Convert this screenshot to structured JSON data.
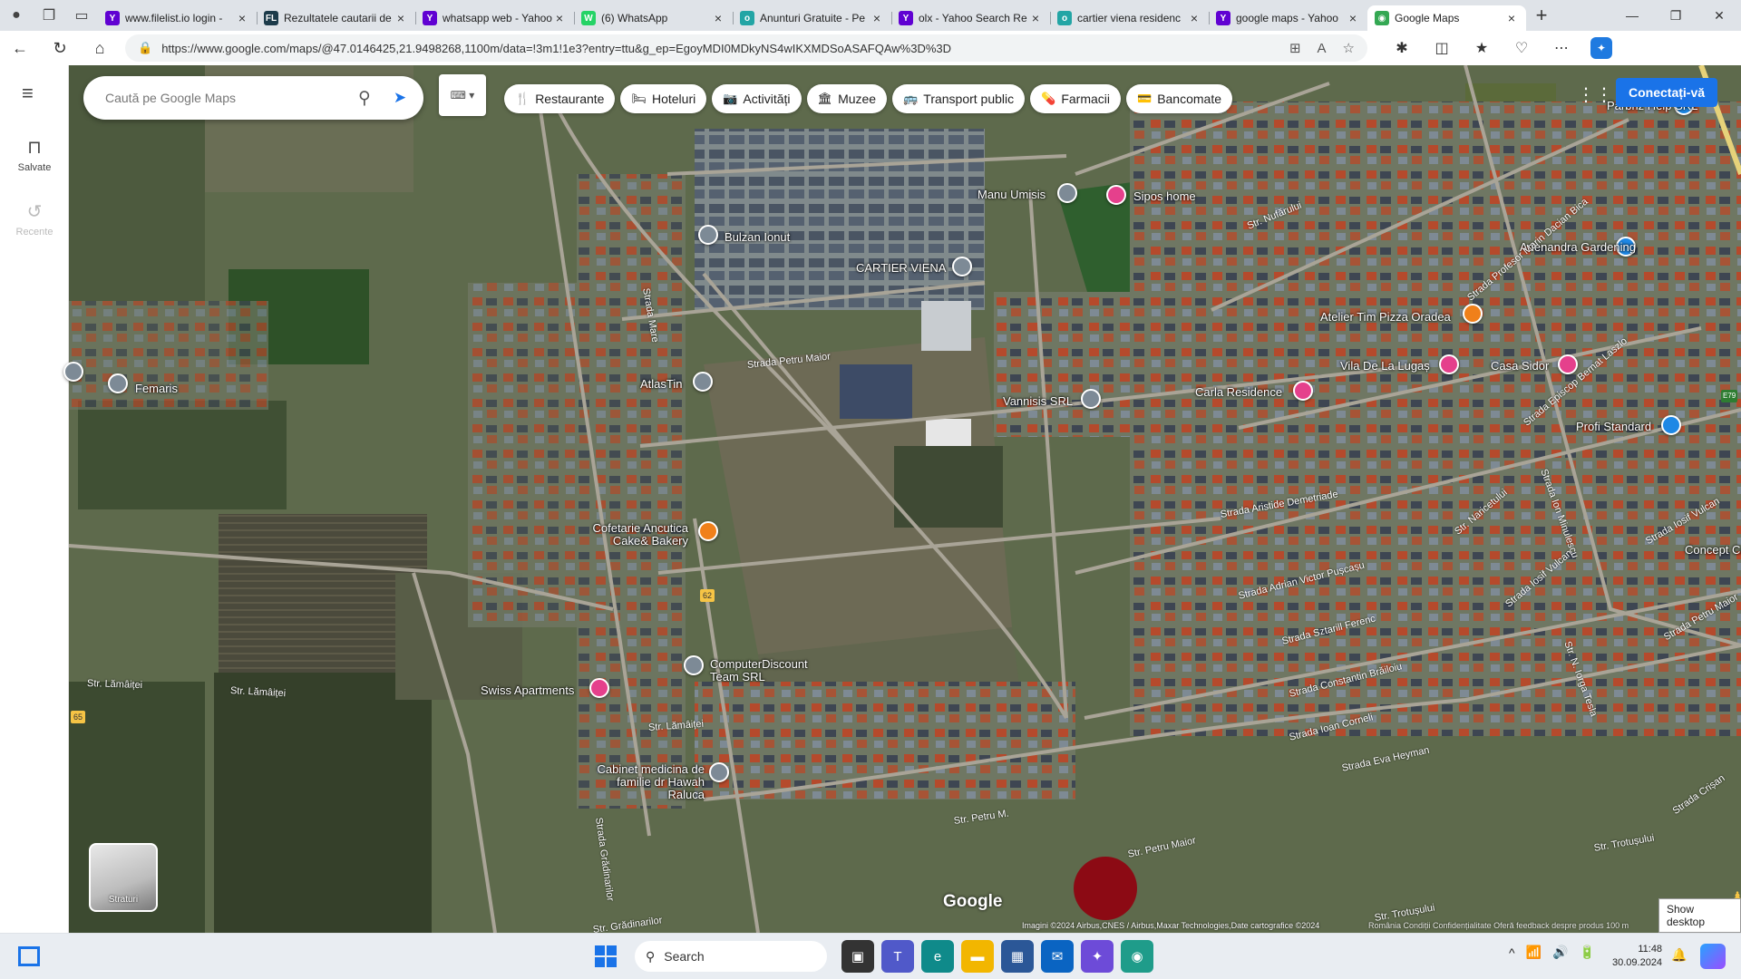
{
  "browser": {
    "tabs": [
      {
        "title": "www.filelist.io login -",
        "fav": "Y",
        "favColor": "#6001d2"
      },
      {
        "title": "Rezultatele cautarii de",
        "fav": "FL",
        "favColor": "#1c3b4a"
      },
      {
        "title": "whatsapp web - Yahoo",
        "fav": "Y",
        "favColor": "#6001d2"
      },
      {
        "title": "(6) WhatsApp",
        "fav": "W",
        "favColor": "#25d366"
      },
      {
        "title": "Anunturi Gratuite - Pe",
        "fav": "o",
        "favColor": "#23a5a5"
      },
      {
        "title": "olx - Yahoo Search Re",
        "fav": "Y",
        "favColor": "#6001d2"
      },
      {
        "title": "cartier viena residenc",
        "fav": "o",
        "favColor": "#23a5a5"
      },
      {
        "title": "google maps - Yahoo",
        "fav": "Y",
        "favColor": "#6001d2"
      },
      {
        "title": "Google Maps",
        "fav": "◉",
        "favColor": "#34a853",
        "active": true
      }
    ],
    "url": "https://www.google.com/maps/@47.0146425,21.9498268,1100m/data=!3m1!1e3?entry=ttu&g_ep=EgoyMDI0MDkyNS4wIKXMDSoASAFQAw%3D%3D"
  },
  "leftrail": {
    "saved": "Salvate",
    "recent": "Recente"
  },
  "search": {
    "placeholder": "Caută pe Google Maps"
  },
  "chips": [
    {
      "icon": "🍴",
      "label": "Restaurante"
    },
    {
      "icon": "🛏",
      "label": "Hoteluri"
    },
    {
      "icon": "📷",
      "label": "Activități"
    },
    {
      "icon": "🏛",
      "label": "Muzee"
    },
    {
      "icon": "🚌",
      "label": "Transport public"
    },
    {
      "icon": "💊",
      "label": "Farmacii"
    },
    {
      "icon": "💳",
      "label": "Bancomate"
    }
  ],
  "signin": "Conectați-vă",
  "layers": "Straturi",
  "places": [
    {
      "name": "Parbriz Help SRL",
      "color": "blue"
    },
    {
      "name": "Manu Umisis",
      "color": "gray"
    },
    {
      "name": "Sipos home",
      "color": "pink"
    },
    {
      "name": "Bulzan Ionut",
      "color": "gray"
    },
    {
      "name": "CARTIER VIENA",
      "color": "gray"
    },
    {
      "name": "Adenandra Gardening",
      "color": "blue"
    },
    {
      "name": "Atelier Tim Pizza Oradea",
      "color": "orange"
    },
    {
      "name": "Vila De La Lugaș",
      "color": "pink"
    },
    {
      "name": "Casa Sidor",
      "color": "pink"
    },
    {
      "name": "Femaris",
      "color": "gray"
    },
    {
      "name": "AtlasTin",
      "color": "gray"
    },
    {
      "name": "Vannisis SRL",
      "color": "gray"
    },
    {
      "name": "Carla Residence",
      "color": "pink"
    },
    {
      "name": "Profi Standard",
      "color": "blue"
    },
    {
      "name": "Cofetarie Ancutica Cake& Bakery",
      "color": "orange"
    },
    {
      "name": "Concept Ca",
      "color": "gray"
    },
    {
      "name": "ComputerDiscount Team SRL",
      "color": "gray"
    },
    {
      "name": "Swiss Apartments",
      "color": "pink"
    },
    {
      "name": "Cabinet medicina de familie dr Hawah Raluca",
      "color": "gray"
    }
  ],
  "streets": [
    "Strada Mare",
    "Strada Petru Maior",
    "Str. Nufărului",
    "Strada Profesor Marin Dacian Bica",
    "Strada Episcop Bernat Laszlo",
    "Strada Aristide Demetriade",
    "Strada Adrian Victor Pușcașu",
    "Strada Sztarill Ferenc",
    "Strada Constantin Brăiloiu",
    "Strada Ioan Corneli",
    "Strada Eva Heyman",
    "Str. Lămâiței",
    "Str. Lămâiței",
    "Str. Lămâiței",
    "Str. Petru Maior",
    "Strada Grădinarilor",
    "Str. Grădinarilor",
    "Str. Trotușului",
    "Str. Trotușului",
    "Str. N. Iorga Tesla",
    "Strada Iosif Vulcan",
    "Str. Naricetului",
    "Strada Ion Minulescu",
    "Strada Petru Maior",
    "Strada Iosif Vulcan",
    "Strada Crișan",
    "Str. Petru M."
  ],
  "road_badges": [
    "62",
    "65",
    "E79"
  ],
  "attribution": "Imagini ©2024 Airbus,CNES / Airbus,Maxar Technologies,Date cartografice ©2024",
  "footer_links": "România   Condiții   Confidențialitate   Oferă feedback despre produs   100 m",
  "google": "Google",
  "show_desktop": "Show desktop",
  "taskbar": {
    "search": "Search",
    "time": "11:48",
    "date": "30.09.2024"
  }
}
